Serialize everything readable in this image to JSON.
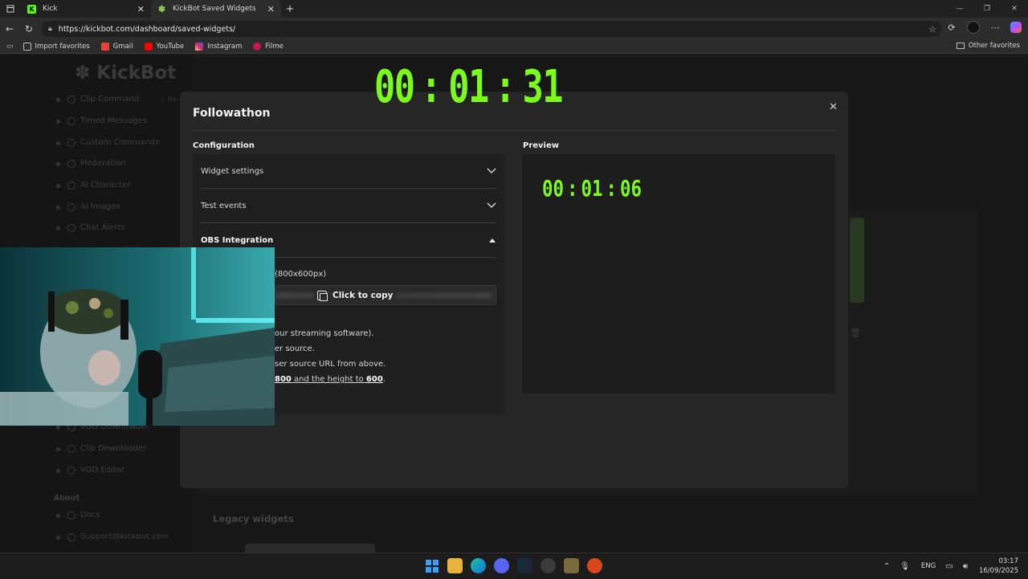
{
  "browser": {
    "tabs": [
      {
        "title": "Kick",
        "icon": "kick-icon",
        "color": "#53fc18"
      },
      {
        "title": "KickBot Saved Widgets",
        "icon": "kickbot-icon",
        "color": "#a6f24a"
      }
    ],
    "url": "https://kickbot.com/dashboard/saved-widgets/",
    "favorites": [
      {
        "label": "Import favorites"
      },
      {
        "label": "Gmail",
        "color": "#ea4335"
      },
      {
        "label": "YouTube",
        "color": "#ff0000"
      },
      {
        "label": "Instagram",
        "color": "#d62976"
      },
      {
        "label": "Filme",
        "color": "#c2185b"
      }
    ],
    "other_favorites": "Other favorites"
  },
  "sidebar": {
    "logo": "KickBot",
    "items": [
      "Clip Command",
      "Timed Messages",
      "Custom Commands",
      "Moderation",
      "AI Character",
      "AI Images",
      "Chat Alerts"
    ],
    "hot": "Ho",
    "lower_items": [
      "VOD Downloader",
      "Clip Downloader",
      "VOD Editor"
    ],
    "about_heading": "About",
    "about_items": [
      "Docs",
      "Support@kickbot.com"
    ]
  },
  "big_timer": {
    "h": "00",
    "m": "01",
    "s": "31",
    "sep": ":"
  },
  "modal": {
    "title": "Followathon",
    "configuration_label": "Configuration",
    "preview_label": "Preview",
    "accordions": [
      {
        "label": "Widget settings",
        "chevron": "⌄"
      },
      {
        "label": "Test events",
        "chevron": "⌄"
      },
      {
        "label": "OBS Integration",
        "chevron": "▴"
      }
    ],
    "obs": {
      "size_note": "(800x600px)",
      "copy_label": "Click to copy",
      "line1": "our streaming software).",
      "line2": "er source.",
      "line3": "ser source URL from above.",
      "width_value": "800",
      "height_text": " and the height to ",
      "height_value": "600",
      "end": "."
    }
  },
  "preview_timer": {
    "h": "00",
    "m": "01",
    "s": "06",
    "sep": ":"
  },
  "legacy": "Legacy widgets",
  "taskbar": {
    "lang": "ENG",
    "time": "03:17",
    "date": "16/09/2025"
  },
  "accent": "#7cfa1c"
}
